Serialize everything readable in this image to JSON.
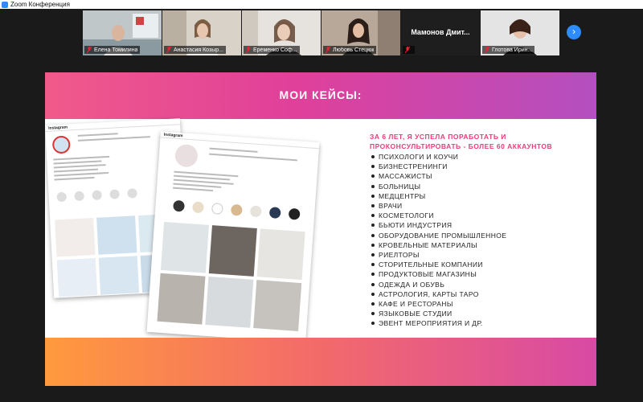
{
  "window": {
    "title": "Zoom Конференция"
  },
  "participants": [
    {
      "name": "Елена Томилина",
      "video": true
    },
    {
      "name": "Анастасия Козыр...",
      "video": true,
      "active": true
    },
    {
      "name": "Еременко Соф...",
      "video": true
    },
    {
      "name": "Любовь Стецюк",
      "video": true
    },
    {
      "name": "Мамонов Дмит...",
      "video": false
    },
    {
      "name": "Глотова Ирин...",
      "video": true
    }
  ],
  "slide": {
    "heading": "МОИ КЕЙСЫ:",
    "lead": "ЗА 6 ЛЕТ, Я УСПЕЛА ПОРАБОТАТЬ И ПРОКОНСУЛЬТИРОВАТЬ - БОЛЕЕ 60 АККАУНТОВ",
    "items": [
      "ПСИХОЛОГИ И КОУЧИ",
      "БИЗНЕСТРЕНИНГИ",
      "МАССАЖИСТЫ",
      "БОЛЬНИЦЫ",
      "МЕДЦЕНТРЫ",
      "ВРАЧИ",
      "КОСМЕТОЛОГИ",
      "БЬЮТИ ИНДУСТРИЯ",
      "ОБОРУДОВАНИЕ ПРОМЫШЛЕННОЕ",
      "КРОВЕЛЬНЫЕ МАТЕРИАЛЫ",
      "РИЕЛТОРЫ",
      "СТОРИТЕЛЬНЫЕ КОМПАНИИ",
      "ПРОДУКТОВЫЕ МАГАЗИНЫ",
      "ОДЕЖДА И ОБУВЬ",
      "АСТРОЛОГИЯ, КАРТЫ ТАРО",
      "КАФЕ И РЕСТОРАНЫ",
      "ЯЗЫКОВЫЕ СТУДИИ",
      "ЭВЕНТ МЕРОПРИЯТИЯ И ДР."
    ],
    "mockups": [
      {
        "brand": "Instagram"
      },
      {
        "brand": "Instagram"
      }
    ]
  },
  "colors": {
    "accent_pink": "#e63d7a",
    "zoom_blue": "#2d8cff",
    "active_speaker": "#7cc242"
  }
}
